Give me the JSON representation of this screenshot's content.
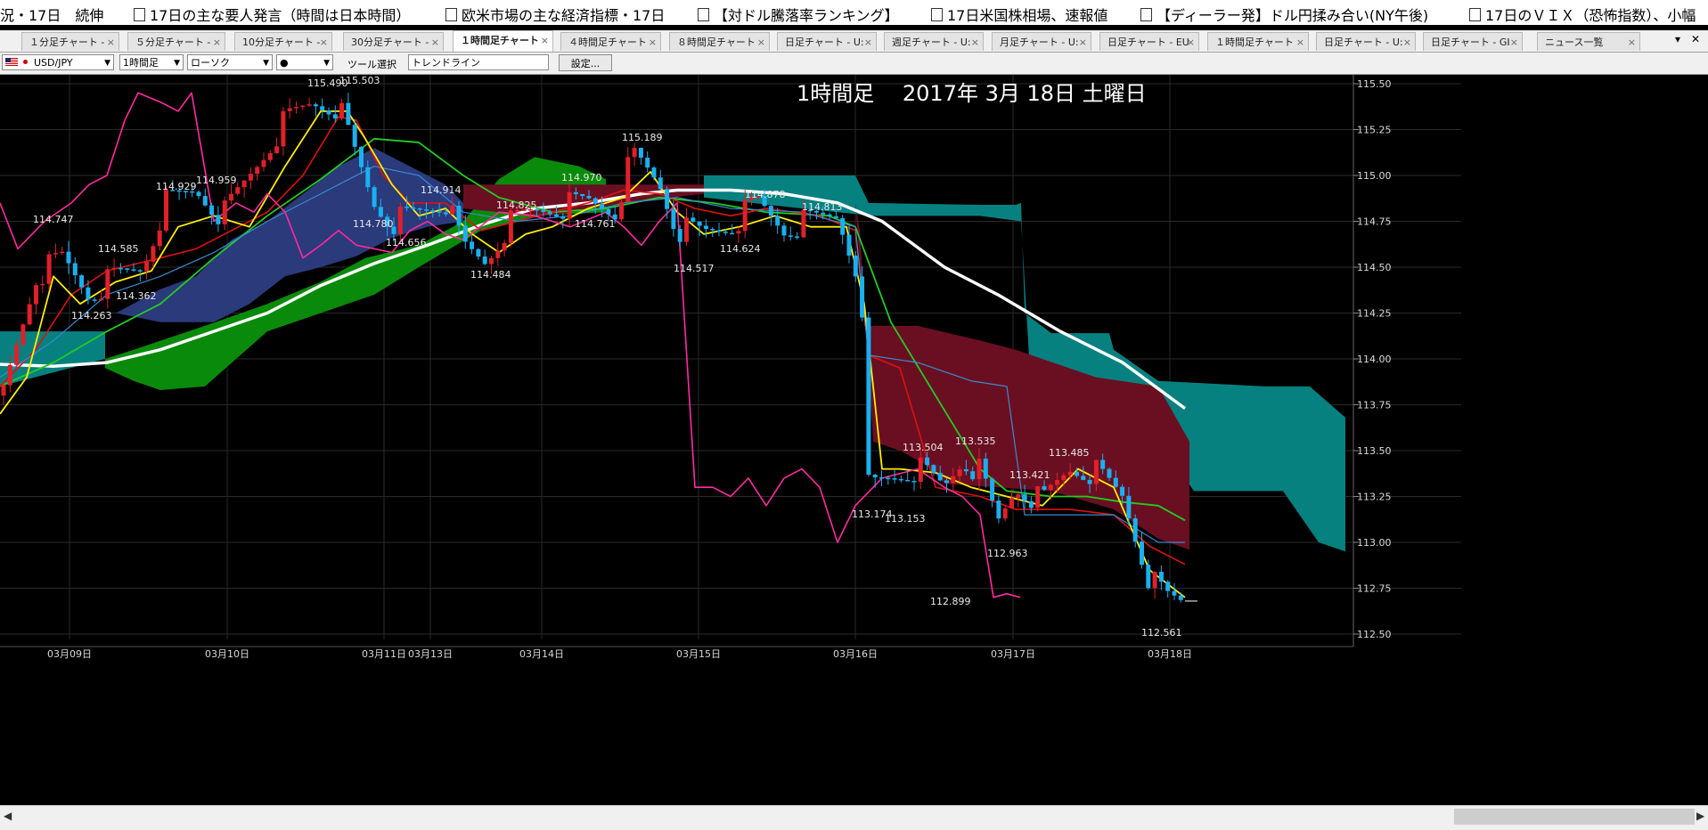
{
  "news": [
    "況・17日　続伸",
    "17日の主な要人発言（時間は日本時間）",
    "欧米市場の主な経済指標・17日",
    "【対ドル騰落率ランキング】",
    "17日米国株相場、速報値",
    "【ディーラー発】ドル円揉み合い(NY午後)",
    "17日のＶＩＸ（恐怖指数）、小幅"
  ],
  "tabs": [
    {
      "label": "１分足チャート -"
    },
    {
      "label": "５分足チャート -"
    },
    {
      "label": "10分足チャート -"
    },
    {
      "label": "30分足チャート -"
    },
    {
      "label": "１時間足チャート"
    },
    {
      "label": "４時間足チャート"
    },
    {
      "label": "８時間足チャート"
    },
    {
      "label": "日足チャート - U:"
    },
    {
      "label": "週足チャート - U:"
    },
    {
      "label": "月足チャート - U:"
    },
    {
      "label": "日足チャート - EU"
    },
    {
      "label": "１時間足チャート"
    },
    {
      "label": "日足チャート - U:"
    },
    {
      "label": "日足チャート - GI"
    },
    {
      "label": "ニュース一覧"
    }
  ],
  "active_tab": 4,
  "toolbar": {
    "pair": "USD/JPY",
    "timeframe": "1時間足",
    "chart_style": "ローソク",
    "tool_label": "ツール選択",
    "tool_value": "トレンドライン",
    "settings_label": "設定..."
  },
  "chart_data": {
    "type": "candlestick",
    "title": "1時間足　 2017年 3月 18日 土曜日",
    "y_ticks": [
      "115.50",
      "115.25",
      "115.00",
      "114.75",
      "114.50",
      "114.25",
      "114.00",
      "113.75",
      "113.50",
      "113.25",
      "113.00",
      "112.75",
      "112.50"
    ],
    "ylim": [
      112.5,
      115.5
    ],
    "x_ticks": [
      "03月09日",
      "03月10日",
      "03月11日",
      "03月13日",
      "03月14日",
      "03月15日",
      "03月16日",
      "03月17日",
      "03月18日"
    ],
    "price_labels": [
      "114.747",
      "114.585",
      "114.362",
      "114.263",
      "114.929",
      "114.959",
      "115.490",
      "115.503",
      "114.780",
      "114.656",
      "114.914",
      "114.484",
      "114.825",
      "114.970",
      "114.761",
      "115.189",
      "114.517",
      "114.624",
      "114.878",
      "114.813",
      "113.174",
      "113.153",
      "113.504",
      "112.899",
      "113.535",
      "112.963",
      "113.421",
      "113.485",
      "112.561"
    ],
    "colors": {
      "up": "#e0202a",
      "down": "#1ab0f0",
      "cloud_bull": "#0a8a0a",
      "cloud_bear": "#6a0f22",
      "cloud_blue": "#2a3a7a",
      "cloud_teal": "#078080",
      "ma_long": "#ffffff",
      "ma_mid": "#22cc22",
      "ma_short": "#ffee00",
      "line_red": "#e01010",
      "chikou": "#ff2aa0"
    }
  }
}
